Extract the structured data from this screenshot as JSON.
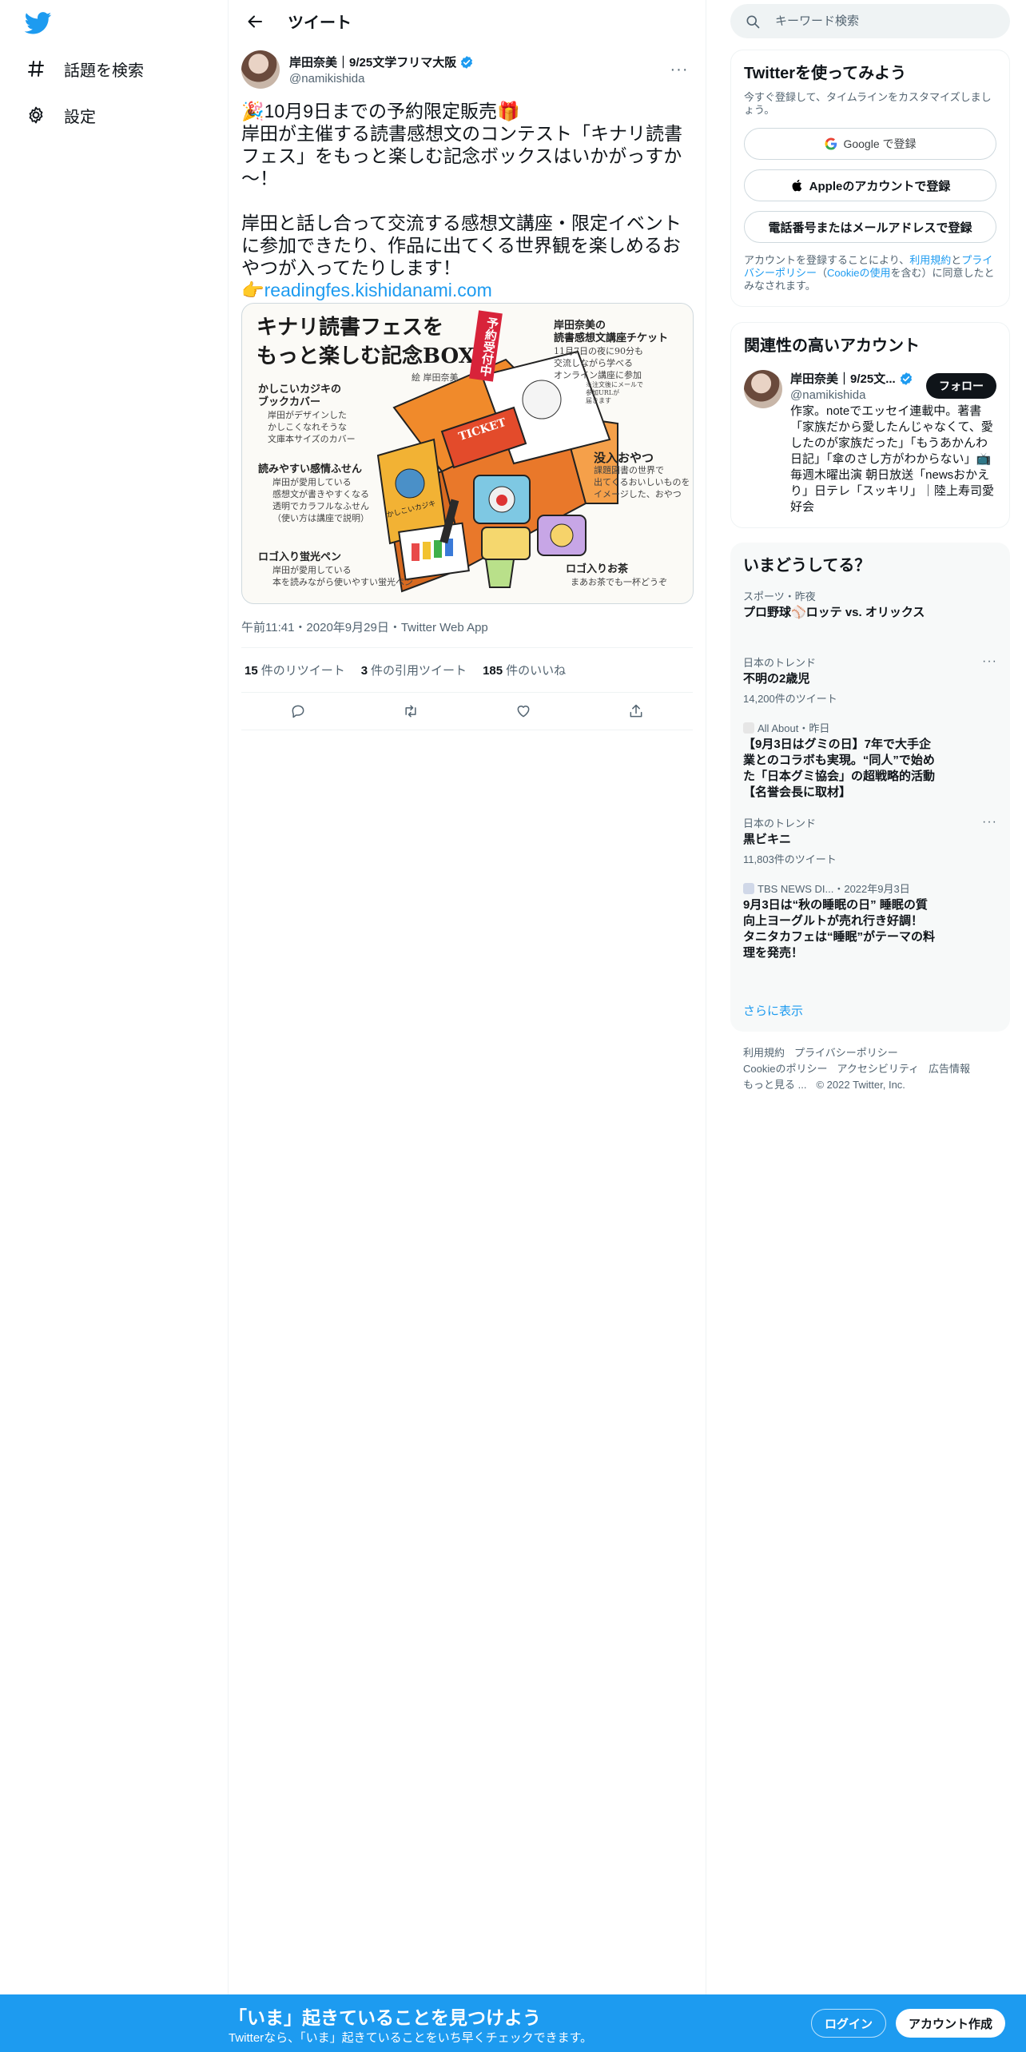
{
  "nav": {
    "logo": "twitter-bird-icon",
    "items": [
      {
        "icon": "hashtag-icon",
        "label": "話題を検索"
      },
      {
        "icon": "gear-icon",
        "label": "設定"
      }
    ]
  },
  "main": {
    "header_title": "ツイート",
    "tweet": {
      "author_name": "岸田奈美｜9/25文学フリマ大阪",
      "author_handle": "@namikishida",
      "more": "···",
      "text_lines": [
        "🎉10月9日までの予約限定販売🎁",
        "岸田が主催する読書感想文のコンテスト「キナリ読書",
        "フェス」をもっと楽しむ記念ボックスはいかがっすか",
        "〜！",
        "",
        "岸田と話し合って交流する感想文講座・限定イベント",
        "に参加できたり、作品に出てくる世界観を楽しめるお",
        "やつが入ってたりします！"
      ],
      "link_emoji": "👉",
      "link": "readingfes.kishidanami.com",
      "media": {
        "title_line1": "キナリ読書フェスを",
        "title_line2": "もっと楽しむ記念BOX",
        "illustrator": "絵 岸田奈美",
        "badge": "予約受付中",
        "ticket_head1": "岸田奈美の",
        "ticket_head2": "読書感想文講座チケット",
        "ticket_desc1": "11月7日の夜に90分も",
        "ticket_desc2": "交流しながら学べる",
        "ticket_desc3": "オンライン講座に参加",
        "ticket_note1": "※注文後にメールで",
        "ticket_note2": "参加URLが",
        "ticket_note3": "届きます",
        "cover_head1": "かしこいカジキの",
        "cover_head2": "ブックカバー",
        "cover_desc1": "岸田がデザインした",
        "cover_desc2": "かしこくなれそうな",
        "cover_desc3": "文庫本サイズのカバー",
        "sticky_head": "読みやすい感情ふせん",
        "sticky_desc1": "岸田が愛用している",
        "sticky_desc2": "感想文が書きやすくなる",
        "sticky_desc3": "透明でカラフルなふせん",
        "sticky_desc4": "（使い方は講座で説明）",
        "snack_head": "没入おやつ",
        "snack_desc1": "課題図書の世界で",
        "snack_desc2": "出てくるおいしいものを",
        "snack_desc3": "イメージした、おやつ",
        "pen_head": "ロゴ入り蛍光ペン",
        "pen_desc1": "岸田が愛用している",
        "pen_desc2": "本を読みながら使いやすい蛍光ペン",
        "tea_head": "ロゴ入りお茶",
        "tea_desc": "まあお茶でも一杯どうぞ",
        "ticket_word": "TICKET",
        "book_label": "かしこいカジキ"
      },
      "meta": "午前11:41・2020年9月29日・Twitter Web App",
      "retweets": {
        "count": "15",
        "label": "件のリツイート"
      },
      "quotes": {
        "count": "3",
        "label": "件の引用ツイート"
      },
      "likes": {
        "count": "185",
        "label": "件のいいね"
      }
    }
  },
  "search": {
    "placeholder": "キーワード検索"
  },
  "signup": {
    "title": "Twitterを使ってみよう",
    "subtitle": "今すぐ登録して、タイムラインをカスタマイズしましょう。",
    "google_label": "Google で登録",
    "apple_label": "Appleのアカウントで登録",
    "phone_label": "電話番号またはメールアドレスで登録",
    "terms_prefix": "アカウントを登録することにより、",
    "terms_link1": "利用規約",
    "terms_and": "と",
    "terms_link2": "プライバシーポリシー",
    "terms_paren_open": "（",
    "terms_link3": "Cookieの使用",
    "terms_suffix": "を含む）に同意したとみなされます。"
  },
  "related": {
    "title": "関連性の高いアカウント",
    "name": "岸田奈美｜9/25文...",
    "handle": "@namikishida",
    "follow_label": "フォロー",
    "bio": "作家。noteでエッセイ連載中。著書「家族だから愛したんじゃなくて、愛したのが家族だった」「もうあかんわ日記」「傘のさし方がわからない」📺毎週木曜出演 朝日放送「newsおかえり」日テレ「スッキリ」｜陸上寿司愛好会"
  },
  "trends": {
    "title": "いまどうしてる？",
    "items": [
      {
        "context": "スポーツ・昨夜",
        "title": "プロ野球⚾ロッテ vs. オリックス",
        "count": ""
      },
      {
        "context": "日本のトレンド",
        "title": "不明の2歳児",
        "count": "14,200件のツイート"
      },
      {
        "context": "All About・昨日",
        "title": "【9月3日はグミの日】7年で大手企業とのコラボも実現。“同人”で始めた「日本グミ協会」の超戦略的活動【名誉会長に取材】",
        "count": ""
      },
      {
        "context": "日本のトレンド",
        "title": "黒ビキニ",
        "count": "11,803件のツイート"
      },
      {
        "context": "TBS NEWS DI...・2022年9月3日",
        "title": "9月3日は“秋の睡眠の日” 睡眠の質向上ヨーグルトが売れ行き好調！ タニタカフェは“睡眠”がテーマの料理を発売！",
        "count": ""
      }
    ],
    "show_more": "さらに表示"
  },
  "footer": {
    "links": [
      "利用規約",
      "プライバシーポリシー",
      "Cookieのポリシー",
      "アクセシビリティ",
      "広告情報",
      "もっと見る ...",
      "© 2022 Twitter, Inc."
    ]
  },
  "bottom_bar": {
    "title": "「いま」起きていることを見つけよう",
    "subtitle": "Twitterなら、「いま」起きていることをいち早くチェックできます。",
    "login_label": "ログイン",
    "signup_label": "アカウント作成"
  },
  "colors": {
    "accent": "#1d9bf0",
    "text": "#0f1419",
    "muted": "#536471"
  }
}
